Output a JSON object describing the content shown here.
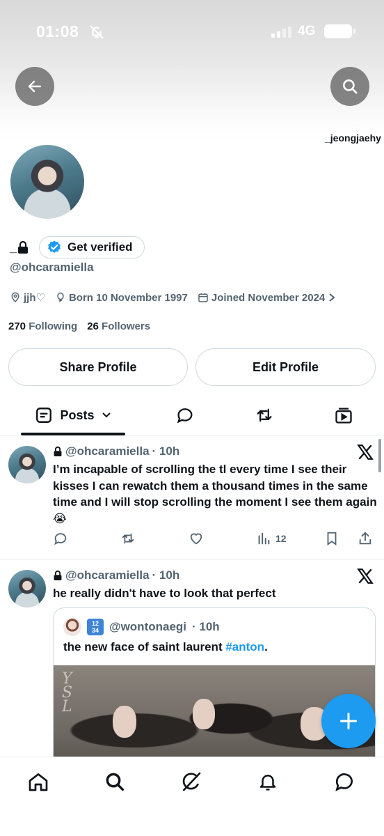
{
  "status_bar": {
    "time": "01:08",
    "network": "4G",
    "icons": [
      "bell-slash-icon",
      "signal-icon",
      "battery-icon"
    ]
  },
  "header": {
    "back_icon": "arrow-left-icon",
    "search_icon": "search-icon",
    "peek_handle": "_jeongjaehy"
  },
  "profile": {
    "display_name": "_",
    "get_verified_label": "Get verified",
    "handle": "@ohcaramiella",
    "bio_location": "jjh♡",
    "born": "Born 10 November 1997",
    "joined": "Joined November 2024",
    "following_count": "270",
    "following_label": "Following",
    "followers_count": "26",
    "followers_label": "Followers",
    "share_label": "Share Profile",
    "edit_label": "Edit Profile"
  },
  "tabs": {
    "posts_label": "Posts"
  },
  "posts": [
    {
      "handle": "@ohcaramiella",
      "time": "· 10h",
      "text": "I’m incapable of scrolling the tl every time I see their kisses I can rewatch them a thousand times in the same time and I will stop scrolling the moment I see them again 😭",
      "views": "12"
    },
    {
      "handle": "@ohcaramiella",
      "time": "· 10h",
      "text": "he really didn't have to look that perfect",
      "quote": {
        "handle": "@wontonaegi",
        "time": "· 10h",
        "badge": "1234",
        "text": "the new face of saint laurent ",
        "hashtag": "#anton",
        "trail": "."
      }
    }
  ],
  "colors": {
    "accent": "#1d9bf0",
    "text": "#0f1419",
    "muted": "#536471",
    "border": "#cfd9de"
  }
}
